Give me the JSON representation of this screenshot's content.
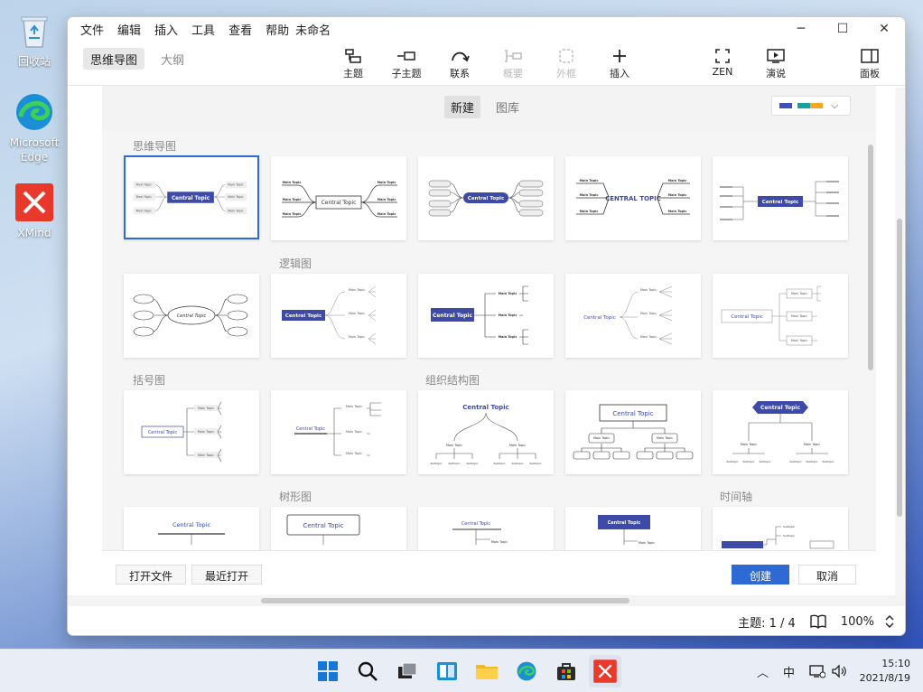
{
  "desktop": {
    "icons": [
      {
        "label": "回收站"
      },
      {
        "label": "Microsoft Edge"
      },
      {
        "label": "XMind"
      }
    ]
  },
  "menubar": {
    "items": [
      "文件",
      "编辑",
      "插入",
      "工具",
      "查看",
      "帮助"
    ],
    "title": "未命名"
  },
  "toolbar": {
    "view_tabs": [
      "思维导图",
      "大纲"
    ],
    "tools": [
      {
        "label": "主题",
        "icon": "topic-icon"
      },
      {
        "label": "子主题",
        "icon": "subtopic-icon"
      },
      {
        "label": "联系",
        "icon": "relationship-icon"
      },
      {
        "label": "概要",
        "icon": "summary-icon"
      },
      {
        "label": "外框",
        "icon": "boundary-icon"
      },
      {
        "label": "插入",
        "icon": "plus-icon"
      },
      {
        "label": "ZEN",
        "icon": "zen-icon"
      },
      {
        "label": "演说",
        "icon": "pitch-icon"
      },
      {
        "label": "面板",
        "icon": "panel-icon"
      }
    ]
  },
  "dialog": {
    "tabs": [
      "新建",
      "图库"
    ],
    "theme_colors": [
      "#3f51b5",
      "#19a0a0",
      "#f5a623"
    ],
    "sections": {
      "mindmap": "思维导图",
      "logic": "逻辑图",
      "brace": "括号图",
      "org": "组织结构图",
      "tree": "树形图",
      "timeline": "时间轴"
    },
    "card_text": {
      "central": "Central Topic",
      "central_upper": "CENTRAL TOPIC",
      "main": "Main Topic",
      "sub": "Subtopic"
    },
    "footer": {
      "open_file": "打开文件",
      "recent": "最近打开",
      "create": "创建",
      "cancel": "取消"
    }
  },
  "status": {
    "topics": "主题: 1 / 4",
    "zoom": "100%"
  },
  "taskbar": {
    "ime": "中",
    "time": "15:10",
    "date": "2021/8/19"
  }
}
